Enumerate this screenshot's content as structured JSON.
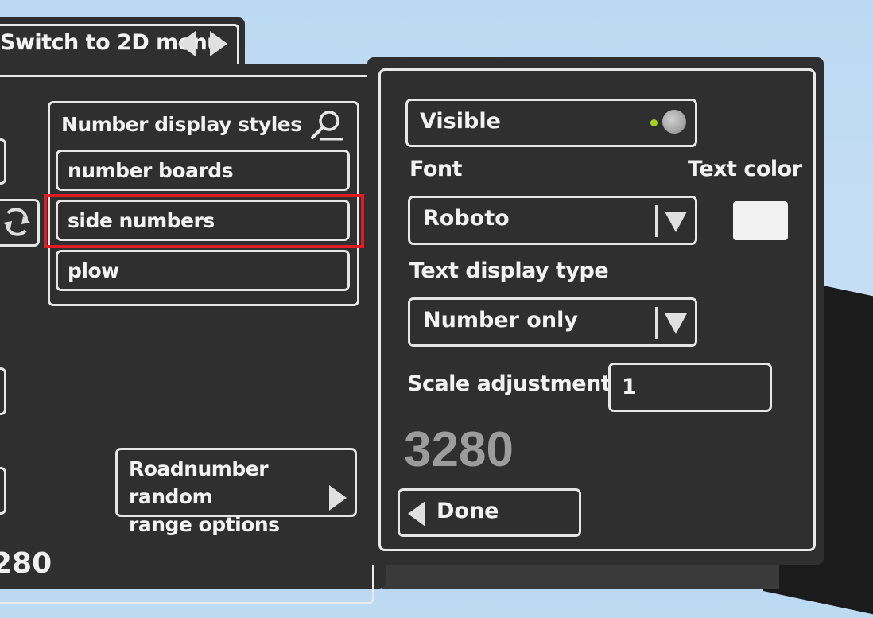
{
  "header": {
    "switch_label": "Switch to 2D menu"
  },
  "styles_panel": {
    "title": "Number display styles",
    "items": [
      {
        "label": "number boards"
      },
      {
        "label": "side numbers",
        "selected": true
      },
      {
        "label": "plow"
      }
    ]
  },
  "range_button": {
    "line1": "Roadnumber random",
    "line2": "range options"
  },
  "bottom_number": "280",
  "properties": {
    "visible_label": "Visible",
    "font_label": "Font",
    "text_color_label": "Text color",
    "font_value": "Roboto",
    "text_display_type_label": "Text display type",
    "text_display_type_value": "Number only",
    "scale_label": "Scale adjustment",
    "scale_value": "1",
    "preview_number": "3280",
    "done_label": "Done"
  },
  "colors": {
    "panel": "#2f2f2f",
    "border": "#e9e9e9",
    "highlight": "#e11b22",
    "indicator": "#a5d21f",
    "text_color_swatch": "#f2f2f2"
  },
  "icons": {
    "search": "search-icon",
    "refresh": "refresh-icon",
    "arrow_left": "triangle-left-icon",
    "arrow_right": "triangle-right-icon",
    "dropdown": "triangle-down-icon"
  }
}
